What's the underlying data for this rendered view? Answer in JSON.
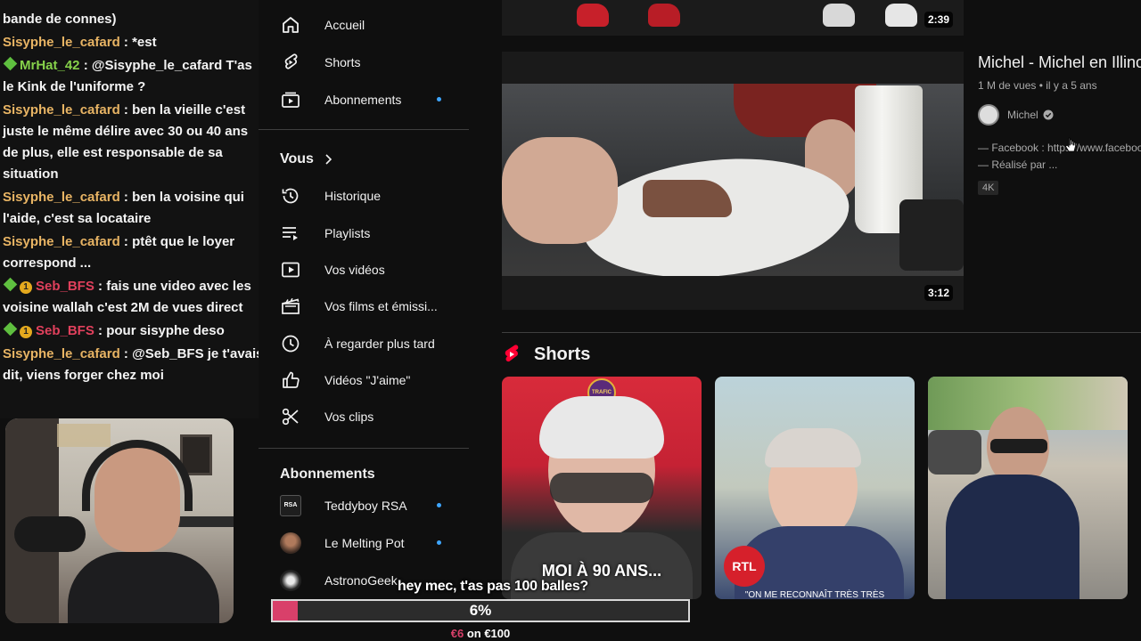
{
  "chat": {
    "messages": [
      {
        "user": "",
        "text": "bande de connes)",
        "badges": []
      },
      {
        "user": "Sisyphe_le_cafard",
        "sep": " : ",
        "text": "*est",
        "color": "gold",
        "badges": []
      },
      {
        "user": "MrHat_42",
        "sep": " : ",
        "text": "@Sisyphe_le_cafard T'as le Kink de l'uniforme ?",
        "color": "green",
        "badges": [
          "diamond"
        ]
      },
      {
        "user": "Sisyphe_le_cafard",
        "sep": " : ",
        "text": "ben la vieille c'est juste le même délire avec 30 ou 40 ans de plus, elle est responsable de sa situation",
        "color": "gold",
        "badges": []
      },
      {
        "user": "Sisyphe_le_cafard",
        "sep": " : ",
        "text": "ben la voisine qui l'aide, c'est sa locataire",
        "color": "gold",
        "badges": []
      },
      {
        "user": "Sisyphe_le_cafard",
        "sep": " : ",
        "text": "ptêt que le loyer correspond ...",
        "color": "gold",
        "badges": []
      },
      {
        "user": "Seb_BFS",
        "sep": " : ",
        "text": "fais une video avec les voisine wallah c'est 2M de vues direct",
        "color": "red",
        "badges": [
          "diamond",
          "coin"
        ]
      },
      {
        "user": "Seb_BFS",
        "sep": " : ",
        "text": "pour sisyphe deso",
        "color": "red",
        "badges": [
          "diamond",
          "coin"
        ]
      },
      {
        "user": "Sisyphe_le_cafard",
        "sep": " : ",
        "text": "@Seb_BFS je t'avais dit, viens forger chez moi",
        "color": "gold",
        "badges": []
      }
    ],
    "coin_badge_text": "1"
  },
  "sidebar": {
    "items": [
      {
        "label": "Accueil",
        "icon": "home-icon"
      },
      {
        "label": "Shorts",
        "icon": "shorts-icon"
      },
      {
        "label": "Abonnements",
        "icon": "subscriptions-icon"
      }
    ],
    "you_title": "Vous",
    "you_items": [
      {
        "label": "Historique",
        "icon": "history-icon"
      },
      {
        "label": "Playlists",
        "icon": "playlists-icon"
      },
      {
        "label": "Vos vidéos",
        "icon": "your-videos-icon"
      },
      {
        "label": "Vos films et émissi...",
        "icon": "movies-icon"
      },
      {
        "label": "À regarder plus tard",
        "icon": "watch-later-icon"
      },
      {
        "label": "Vidéos \"J'aime\"",
        "icon": "liked-icon"
      },
      {
        "label": "Vos clips",
        "icon": "clips-icon"
      }
    ],
    "subs_title": "Abonnements",
    "subs": [
      {
        "label": "Teddyboy RSA",
        "avatar_text": "RSA"
      },
      {
        "label": "Le Melting Pot"
      },
      {
        "label": "AstronoGeek"
      }
    ]
  },
  "videos": {
    "top_duration": "2:39",
    "main_duration": "3:12",
    "main_title": "Michel - Michel en Illinois",
    "main_meta": "1 M de vues • il y a 5 ans",
    "channel": "Michel",
    "desc_line1": "— Facebook : https://www.facebook.com",
    "desc_line2": "— Réalisé par ...",
    "badge": "4K"
  },
  "shorts": {
    "title": "Shorts",
    "items": [
      {
        "caption": "MOI À 90 ANS...",
        "logo": "TRAFIC"
      },
      {
        "caption": "\"ON ME RECONNAÎT TRÈS TRÈS",
        "logo": "RTL"
      },
      {
        "caption": ""
      }
    ]
  },
  "donation": {
    "message": "hey mec, t'as pas 100 balles?",
    "percent_text": "6%",
    "progress": 0.06,
    "current": "€6",
    "on_text": " on ",
    "goal": "€100"
  },
  "colors": {
    "accent_pink": "#d9406a",
    "chat_gold": "#e8b464",
    "chat_green": "#86d14a",
    "chat_red": "#e0405c",
    "yt_blue_dot": "#3ea6ff",
    "shorts_red": "#ff0033"
  }
}
